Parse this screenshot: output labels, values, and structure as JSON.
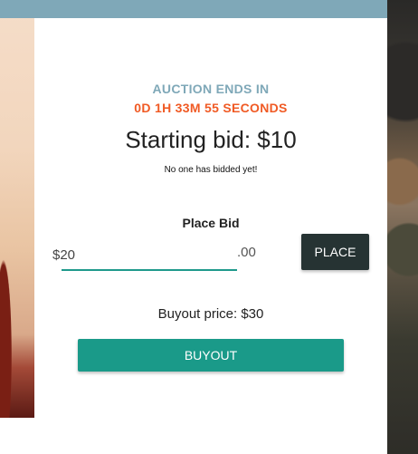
{
  "colors": {
    "topbar": "#7fa8b8",
    "auction_label": "#7fa8b8",
    "countdown": "#f05a24",
    "place_button_bg": "#263333",
    "buyout_button_bg": "#1a9a89",
    "input_underline": "#1f9a8c"
  },
  "auction": {
    "ends_label": "AUCTION ENDS IN",
    "countdown": "0D 1H 33M 55 SECONDS",
    "starting_bid": "Starting bid: $10",
    "bid_status": "No one has bidded yet!"
  },
  "bid": {
    "label": "Place Bid",
    "value": "$20",
    "cents": ".00",
    "place_label": "PLACE"
  },
  "buyout": {
    "price_text": "Buyout price: $30",
    "button_label": "BUYOUT"
  }
}
